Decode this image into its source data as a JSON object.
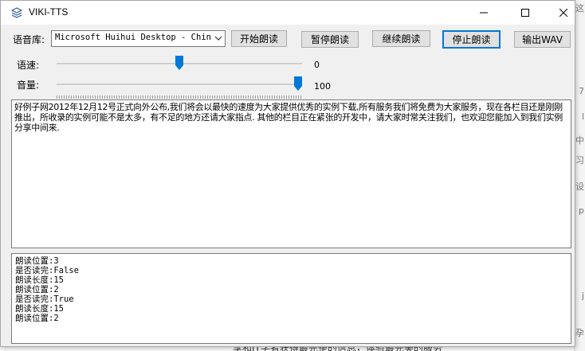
{
  "window": {
    "title": "VIKI-TTS"
  },
  "toolbar": {
    "voice_label": "语音库:",
    "voice_value": "Microsoft Huihui Desktop - Chine:",
    "start_label": "开始朗读",
    "pause_label": "暂停朗读",
    "resume_label": "继续朗读",
    "stop_label": "停止朗读",
    "export_label": "输出WAV"
  },
  "rate": {
    "label": "语速:",
    "value": "0",
    "min": -10,
    "max": 10,
    "level": 0
  },
  "volume": {
    "label": "音量:",
    "value": "100",
    "min": 0,
    "max": 100,
    "level": 100
  },
  "text_content": "好例子网2012年12月12号正式向外公布,我们将会以最快的速度为大家提供优秀的实例下载,所有服务我们将免费为大家服务，现在各栏目还是刚刚推出，所收录的实例可能不是太多，有不足的地方还请大家指点. 其他的栏目正在紧张的开发中，请大家时常关注我们，也欢迎您能加入到我们实例分享中间来.",
  "log_lines": [
    "朗读位置:3",
    "是否读完:False",
    "朗读长度:15",
    "朗读位置:2",
    "是否读完:True",
    "朗读长度:15",
    "朗读位置:2"
  ],
  "background": {
    "edge_chars": [
      "这",
      "7",
      "l",
      "中",
      "习",
      "设",
      "p",
      "j",
      "孕"
    ],
    "bottom_text": "享和IT学者获得最完整的信息，体验最完美的服务"
  },
  "colors": {
    "accent": "#0078d7",
    "window_bg": "#f0f0f0",
    "button_bg": "#e1e1e1"
  }
}
